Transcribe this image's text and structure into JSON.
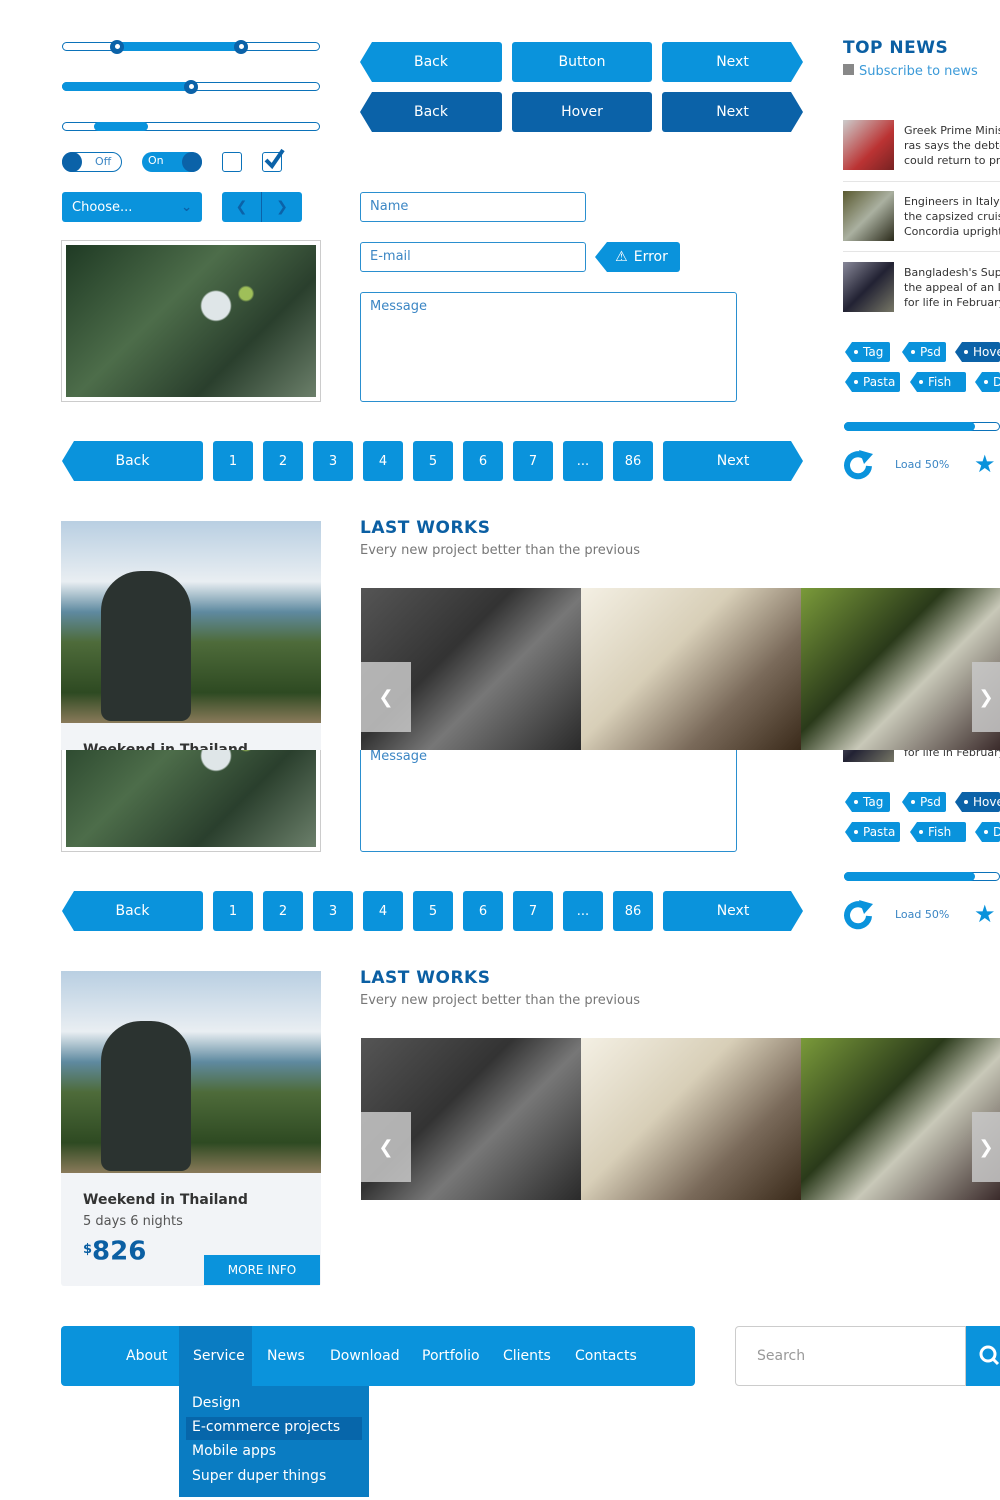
{
  "colors": {
    "primary": "#0a93dc",
    "dark": "#0b62a8",
    "heading": "#0b5fa3"
  },
  "sliders": [
    {
      "range": [
        21,
        69
      ]
    },
    {
      "value": 50
    },
    {
      "scroll_start": 12,
      "scroll_end": 33
    }
  ],
  "toggles": {
    "off_label": "Off",
    "on_label": "On"
  },
  "checkboxes": [
    {
      "checked": false
    },
    {
      "checked": true
    }
  ],
  "select": {
    "value": "Choose..."
  },
  "buttons": {
    "row1": [
      "Back",
      "Button",
      "Next"
    ],
    "row2": [
      "Back",
      "Hover",
      "Next"
    ]
  },
  "form": {
    "name_placeholder": "Name",
    "email_placeholder": "E-mail",
    "message_placeholder": "Message",
    "error_label": "Error"
  },
  "pagination": {
    "back": "Back",
    "pages": [
      "1",
      "2",
      "3",
      "4",
      "5",
      "6",
      "7",
      "...",
      "86"
    ],
    "next": "Next"
  },
  "top_news": {
    "title": "TOP NEWS",
    "subscribe": "Subscribe to news",
    "items": [
      {
        "lines": [
          "Greek Prime Minis",
          "ras says the debt-",
          "could return to pr"
        ]
      },
      {
        "lines": [
          "Engineers in Italy s",
          "the capsized cruis",
          "Concordia upright"
        ]
      },
      {
        "lines": [
          "Bangladesh's Supr",
          "the appeal of an Is",
          "for life in February"
        ]
      }
    ]
  },
  "tags": [
    "Tag",
    "Psd",
    "Hove",
    "Pasta",
    "Fish",
    "D"
  ],
  "progress": {
    "value": 83,
    "load_label": "Load 50%"
  },
  "last_works": {
    "title": "LAST WORKS",
    "subtitle": "Every new project better than the previous"
  },
  "card": {
    "title": "Weekend in Thailand",
    "subtitle": "5 days 6 nights",
    "currency": "$",
    "price": "826",
    "button": "MORE INFO"
  },
  "nav": {
    "items": [
      "About",
      "Service",
      "News",
      "Download",
      "Portfolio",
      "Clients",
      "Contacts"
    ],
    "active": "Service",
    "dropdown": [
      "Design",
      "E-commerce projects",
      "Mobile apps",
      "Super duper things"
    ],
    "dropdown_highlight": "E-commerce projects"
  },
  "search": {
    "placeholder": "Search"
  }
}
